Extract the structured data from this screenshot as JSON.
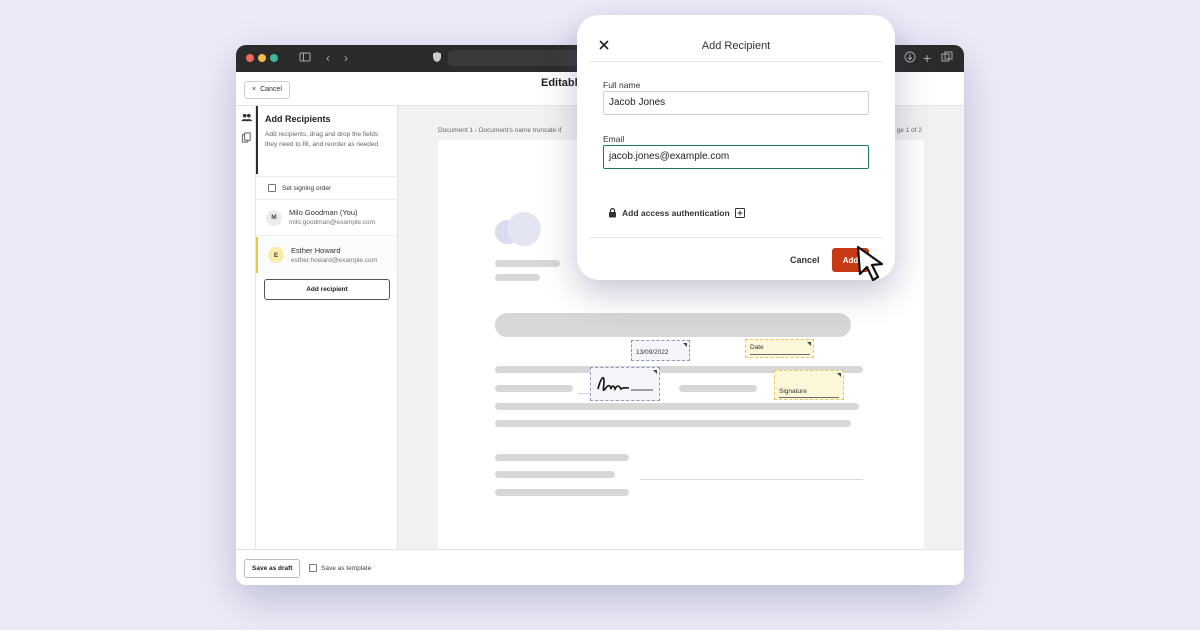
{
  "header": {
    "cancel_label": "Cancel",
    "doc_title": "Editabl"
  },
  "sidebar": {
    "title": "Add Recipients",
    "description": "Add recipients, drag and drop the fields they need to fill, and reorder as needed",
    "signing_order_label": "Set signing order",
    "recipients": [
      {
        "initial": "M",
        "name": "Milo Goodman (You)",
        "email": "milo.goodman@example.com",
        "color": "#ececec"
      },
      {
        "initial": "E",
        "name": "Esther Howard",
        "email": "esther.howard@example.com",
        "color": "#f7ecaa"
      }
    ],
    "add_recipient_label": "Add recipient"
  },
  "document": {
    "label": "Document 1 - Document's name truncate if",
    "page_count": "ge 1 of 2",
    "date_value": "13/09/2022",
    "date_placeholder": "Date",
    "signature_placeholder": "Signature"
  },
  "footer": {
    "save_draft_label": "Save as draft",
    "save_template_label": "Save as template"
  },
  "modal": {
    "title": "Add Recipient",
    "fullname_label": "Full name",
    "fullname_value": "Jacob Jones",
    "email_label": "Email",
    "email_value": "jacob.jones@example.com",
    "auth_label": "Add access authentication",
    "cancel_label": "Cancel",
    "add_label": "Add"
  },
  "colors": {
    "accent": "#c73b14",
    "focus": "#1c7a6a",
    "highlight": "#f7ecaa"
  }
}
